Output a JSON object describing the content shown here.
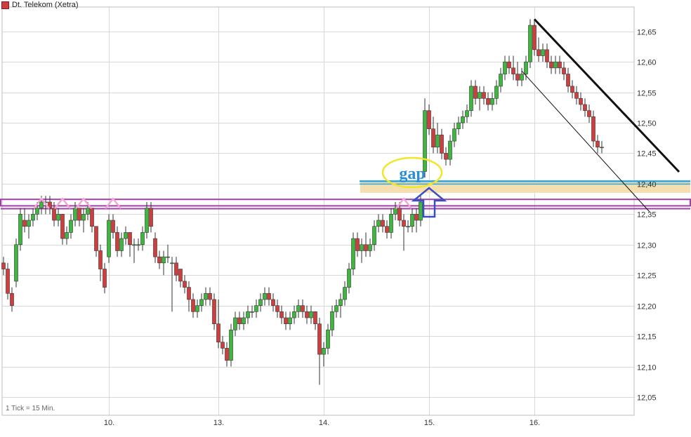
{
  "chart_data": {
    "type": "candlestick",
    "title": "Dt. Telekom (Xetra)",
    "interval_note": "1 Tick = 15 Min.",
    "colors": {
      "up": "#3cb83c",
      "down": "#d23c3c",
      "grid": "#d8d8d8"
    },
    "ylim": [
      12.02,
      12.69
    ],
    "y_ticks": [
      "12,05",
      "12,10",
      "12,15",
      "12,20",
      "12,25",
      "12,30",
      "12,35",
      "12,40",
      "12,45",
      "12,50",
      "12,55",
      "12,60",
      "12,65"
    ],
    "x_ticks": [
      {
        "label": "10.",
        "index": 25
      },
      {
        "label": "13.",
        "index": 51
      },
      {
        "label": "14.",
        "index": 76
      },
      {
        "label": "15.",
        "index": 101
      },
      {
        "label": "16.",
        "index": 126
      }
    ],
    "candles": [
      [
        12.27,
        12.28,
        12.25,
        12.26
      ],
      [
        12.26,
        12.27,
        12.21,
        12.22
      ],
      [
        12.22,
        12.23,
        12.19,
        12.2
      ],
      [
        12.24,
        12.31,
        12.23,
        12.3
      ],
      [
        12.3,
        12.36,
        12.29,
        12.35
      ],
      [
        12.34,
        12.36,
        12.32,
        12.33
      ],
      [
        12.33,
        12.35,
        12.31,
        12.34
      ],
      [
        12.34,
        12.36,
        12.33,
        12.35
      ],
      [
        12.35,
        12.37,
        12.34,
        12.36
      ],
      [
        12.36,
        12.38,
        12.35,
        12.37
      ],
      [
        12.37,
        12.38,
        12.35,
        12.37
      ],
      [
        12.37,
        12.38,
        12.35,
        12.36
      ],
      [
        12.36,
        12.37,
        12.33,
        12.34
      ],
      [
        12.34,
        12.36,
        12.33,
        12.35
      ],
      [
        12.35,
        12.35,
        12.3,
        12.31
      ],
      [
        12.31,
        12.33,
        12.3,
        12.32
      ],
      [
        12.32,
        12.35,
        12.31,
        12.34
      ],
      [
        12.34,
        12.37,
        12.33,
        12.36
      ],
      [
        12.36,
        12.36,
        12.33,
        12.34
      ],
      [
        12.34,
        12.36,
        12.32,
        12.35
      ],
      [
        12.35,
        12.37,
        12.34,
        12.36
      ],
      [
        12.36,
        12.36,
        12.32,
        12.33
      ],
      [
        12.33,
        12.33,
        12.28,
        12.29
      ],
      [
        12.29,
        12.3,
        12.24,
        12.26
      ],
      [
        12.26,
        12.27,
        12.22,
        12.23
      ],
      [
        12.28,
        12.35,
        12.27,
        12.34
      ],
      [
        12.34,
        12.35,
        12.31,
        12.32
      ],
      [
        12.32,
        12.33,
        12.28,
        12.29
      ],
      [
        12.29,
        12.32,
        12.28,
        12.31
      ],
      [
        12.31,
        12.33,
        12.3,
        12.32
      ],
      [
        12.32,
        12.32,
        12.28,
        12.3
      ],
      [
        12.3,
        12.31,
        12.27,
        12.3
      ],
      [
        12.3,
        12.31,
        12.29,
        12.3
      ],
      [
        12.3,
        12.33,
        12.29,
        12.32
      ],
      [
        12.32,
        12.37,
        12.31,
        12.36
      ],
      [
        12.36,
        12.37,
        12.32,
        12.33
      ],
      [
        12.31,
        12.32,
        12.27,
        12.28
      ],
      [
        12.28,
        12.29,
        12.26,
        12.27
      ],
      [
        12.27,
        12.29,
        12.25,
        12.28
      ],
      [
        12.28,
        12.3,
        12.27,
        12.28
      ],
      [
        12.27,
        12.28,
        12.19,
        12.27
      ],
      [
        12.27,
        12.28,
        12.24,
        12.25
      ],
      [
        12.26,
        12.26,
        12.23,
        12.24
      ],
      [
        12.24,
        12.25,
        12.22,
        12.23
      ],
      [
        12.23,
        12.24,
        12.19,
        12.21
      ],
      [
        12.21,
        12.22,
        12.18,
        12.19
      ],
      [
        12.19,
        12.21,
        12.18,
        12.2
      ],
      [
        12.2,
        12.22,
        12.19,
        12.21
      ],
      [
        12.21,
        12.23,
        12.2,
        12.22
      ],
      [
        12.22,
        12.23,
        12.2,
        12.21
      ],
      [
        12.21,
        12.22,
        12.16,
        12.17
      ],
      [
        12.17,
        12.21,
        12.13,
        12.14
      ],
      [
        12.14,
        12.15,
        12.12,
        12.13
      ],
      [
        12.13,
        12.14,
        12.1,
        12.11
      ],
      [
        12.11,
        12.17,
        12.1,
        12.16
      ],
      [
        12.16,
        12.19,
        12.15,
        12.18
      ],
      [
        12.18,
        12.19,
        12.16,
        12.17
      ],
      [
        12.17,
        12.19,
        12.16,
        12.18
      ],
      [
        12.18,
        12.2,
        12.17,
        12.19
      ],
      [
        12.19,
        12.2,
        12.18,
        12.19
      ],
      [
        12.19,
        12.21,
        12.18,
        12.2
      ],
      [
        12.2,
        12.22,
        12.19,
        12.21
      ],
      [
        12.21,
        12.23,
        12.2,
        12.22
      ],
      [
        12.22,
        12.23,
        12.2,
        12.21
      ],
      [
        12.21,
        12.22,
        12.19,
        12.2
      ],
      [
        12.2,
        12.21,
        12.18,
        12.19
      ],
      [
        12.19,
        12.2,
        12.17,
        12.18
      ],
      [
        12.18,
        12.19,
        12.16,
        12.17
      ],
      [
        12.17,
        12.19,
        12.16,
        12.18
      ],
      [
        12.18,
        12.2,
        12.17,
        12.19
      ],
      [
        12.19,
        12.21,
        12.18,
        12.2
      ],
      [
        12.2,
        12.21,
        12.18,
        12.19
      ],
      [
        12.19,
        12.2,
        12.17,
        12.18
      ],
      [
        12.18,
        12.2,
        12.17,
        12.19
      ],
      [
        12.19,
        12.19,
        12.16,
        12.17
      ],
      [
        12.17,
        12.18,
        12.07,
        12.12
      ],
      [
        12.12,
        12.14,
        12.1,
        12.13
      ],
      [
        12.13,
        12.17,
        12.12,
        12.16
      ],
      [
        12.16,
        12.2,
        12.15,
        12.19
      ],
      [
        12.19,
        12.21,
        12.18,
        12.2
      ],
      [
        12.2,
        12.22,
        12.18,
        12.21
      ],
      [
        12.21,
        12.24,
        12.2,
        12.23
      ],
      [
        12.23,
        12.27,
        12.22,
        12.26
      ],
      [
        12.26,
        12.32,
        12.25,
        12.31
      ],
      [
        12.31,
        12.32,
        12.28,
        12.29
      ],
      [
        12.29,
        12.31,
        12.27,
        12.3
      ],
      [
        12.3,
        12.32,
        12.28,
        12.29
      ],
      [
        12.29,
        12.31,
        12.28,
        12.3
      ],
      [
        12.3,
        12.34,
        12.29,
        12.33
      ],
      [
        12.33,
        12.35,
        12.32,
        12.34
      ],
      [
        12.34,
        12.35,
        12.32,
        12.33
      ],
      [
        12.33,
        12.34,
        12.31,
        12.32
      ],
      [
        12.32,
        12.36,
        12.31,
        12.35
      ],
      [
        12.35,
        12.37,
        12.34,
        12.36
      ],
      [
        12.36,
        12.37,
        12.33,
        12.34
      ],
      [
        12.34,
        12.35,
        12.29,
        12.33
      ],
      [
        12.33,
        12.34,
        12.32,
        12.33
      ],
      [
        12.33,
        12.36,
        12.32,
        12.35
      ],
      [
        12.35,
        12.36,
        12.32,
        12.34
      ],
      [
        12.34,
        12.38,
        12.33,
        12.37
      ],
      [
        12.42,
        12.54,
        12.41,
        12.52
      ],
      [
        12.52,
        12.53,
        12.48,
        12.49
      ],
      [
        12.49,
        12.51,
        12.45,
        12.46
      ],
      [
        12.46,
        12.5,
        12.45,
        12.48
      ],
      [
        12.48,
        12.49,
        12.44,
        12.45
      ],
      [
        12.45,
        12.46,
        12.43,
        12.44
      ],
      [
        12.44,
        12.48,
        12.43,
        12.47
      ],
      [
        12.47,
        12.5,
        12.46,
        12.49
      ],
      [
        12.49,
        12.51,
        12.48,
        12.5
      ],
      [
        12.5,
        12.52,
        12.49,
        12.51
      ],
      [
        12.51,
        12.53,
        12.5,
        12.52
      ],
      [
        12.52,
        12.57,
        12.51,
        12.56
      ],
      [
        12.56,
        12.57,
        12.53,
        12.54
      ],
      [
        12.54,
        12.56,
        12.52,
        12.55
      ],
      [
        12.55,
        12.56,
        12.53,
        12.54
      ],
      [
        12.54,
        12.55,
        12.52,
        12.53
      ],
      [
        12.53,
        12.55,
        12.52,
        12.54
      ],
      [
        12.54,
        12.57,
        12.53,
        12.56
      ],
      [
        12.56,
        12.59,
        12.55,
        12.58
      ],
      [
        12.58,
        12.61,
        12.57,
        12.6
      ],
      [
        12.6,
        12.61,
        12.58,
        12.59
      ],
      [
        12.59,
        12.61,
        12.57,
        12.58
      ],
      [
        12.58,
        12.6,
        12.56,
        12.57
      ],
      [
        12.57,
        12.59,
        12.56,
        12.58
      ],
      [
        12.58,
        12.61,
        12.57,
        12.6
      ],
      [
        12.6,
        12.67,
        12.59,
        12.66
      ],
      [
        12.66,
        12.67,
        12.61,
        12.62
      ],
      [
        12.62,
        12.64,
        12.6,
        12.61
      ],
      [
        12.61,
        12.63,
        12.6,
        12.62
      ],
      [
        12.62,
        12.63,
        12.59,
        12.6
      ],
      [
        12.6,
        12.61,
        12.58,
        12.59
      ],
      [
        12.59,
        12.61,
        12.58,
        12.6
      ],
      [
        12.6,
        12.61,
        12.58,
        12.59
      ],
      [
        12.59,
        12.6,
        12.57,
        12.58
      ],
      [
        12.58,
        12.59,
        12.55,
        12.56
      ],
      [
        12.56,
        12.57,
        12.54,
        12.55
      ],
      [
        12.55,
        12.56,
        12.53,
        12.54
      ],
      [
        12.54,
        12.55,
        12.52,
        12.53
      ],
      [
        12.53,
        12.54,
        12.51,
        12.52
      ],
      [
        12.52,
        12.53,
        12.5,
        12.51
      ],
      [
        12.51,
        12.52,
        12.46,
        12.47
      ],
      [
        12.47,
        12.48,
        12.45,
        12.46
      ],
      [
        12.46,
        12.47,
        12.45,
        12.46
      ]
    ],
    "annotations": {
      "gap_label": "gap",
      "gap_zone": [
        12.385,
        12.404
      ],
      "support_upper": 12.372,
      "support_lower": 12.366,
      "resistance_tops": [
        9,
        14,
        19,
        26,
        95
      ],
      "arrow_index": 101,
      "trendline_main": [
        [
          126,
          12.67
        ],
        [
          152,
          12.42
        ]
      ],
      "trendline_thin": [
        [
          123,
          12.585
        ],
        [
          153,
          12.355
        ]
      ]
    }
  }
}
